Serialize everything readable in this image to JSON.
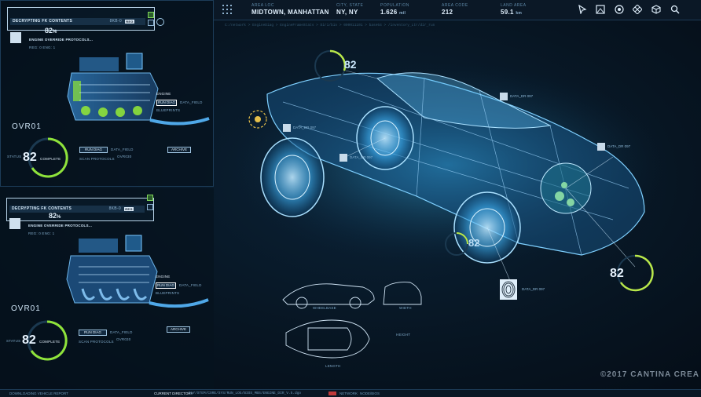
{
  "topbar": {
    "area_loc_label": "AREA LOC",
    "area_loc_value": "MIDTOWN, MANHATTAN",
    "city_state_label": "CITY, STATE",
    "city_state_value": "NY, NY",
    "population_label": "POPULATION",
    "population_value": "1.626",
    "population_unit": "mil",
    "area_code_label": "AREA CODE",
    "area_code_value": "212",
    "land_area_label": "LAND AREA",
    "land_area_value": "59.1",
    "land_area_unit": "km",
    "icons": [
      "cursor-icon",
      "image-icon",
      "target-icon",
      "move-icon",
      "cube-icon",
      "search-icon"
    ],
    "path_text": "C:/network > EngineDiag > EngineFrameStats > Dir1/bin  > 000011101 > base64  > /inventory_Ltr/dir_run"
  },
  "panel_top": {
    "title": "DECRYPTING FK CONTENTS",
    "id": "8KB-0",
    "tag": "REG",
    "percent": "82",
    "percent_suffix": "%",
    "subtitle": "ENGINE OVERRIDE PROTOCOLS...",
    "sub_line": "REG: 0  ENG: 1",
    "run_diag": "RUN DIAG",
    "data_field": "DATA_FIELD",
    "blueprint_label": "BLUEPRINTS",
    "ovr": "OVR01",
    "big_num": "82",
    "big_label": "COMPLETE",
    "run_diag2": "RUN DIAG",
    "data_field2": "DATA_FIELD",
    "scan": "SCAN PROTOCOLS",
    "ovr_small": "OVR030",
    "archive": "ARCHIVE",
    "engine_label": "ENGINE",
    "status_word": "STATUS"
  },
  "panel_bottom": {
    "title": "DECRYPTING FK CONTENTS",
    "id": "8KB-0",
    "tag": "REG",
    "percent": "82",
    "percent_suffix": "%",
    "subtitle": "ENGINE OVERRIDE PROTOCOLS...",
    "sub_line": "REG: 0  ENG: 1",
    "run_diag": "RUN DIAG",
    "data_field": "DATA_FIELD",
    "blueprint_label": "BLUEPRINTS",
    "ovr": "OVR01",
    "big_num": "82",
    "big_label": "COMPLETE",
    "run_diag2": "RUN DIAG",
    "data_field2": "DATA_FIELD",
    "scan": "SCAN PROTOCOLS",
    "ovr_small": "OVR030",
    "archive": "ARCHIVE",
    "engine_label": "ENGINE",
    "status_word": "STATUS"
  },
  "car": {
    "gauge_top": "82",
    "gauge_right": "82",
    "gauge_mid": "82",
    "tag_top_right": "DATA_DR 097",
    "tag_mid": "DATA_DR 097",
    "tag_left": "DATA_DR 097",
    "tag_right": "DATA_DR 097",
    "tag_bottom": "DATA_DR 097",
    "blueprint_left_label": "WHEELBASE",
    "blueprint_front_label": "WIDTH",
    "blueprint_bottom_label": "LENGTH",
    "blueprint_height_label": "HEIGHT"
  },
  "bottombar": {
    "status": "DOWNLOADING VEHICLE REPORT",
    "directory": "CURRENT DIRECTORY",
    "path": "SLY/STEM/CORE/SYS/RUN_LOG/BIOS_MBS/ENGINE_DIR_V.5.dgo",
    "network_a": "NETWORK",
    "network_b": "NODE/BIOS"
  },
  "copyright": "©2017 CANTINA CREA",
  "colors": {
    "accent_blue": "#2fa6ff",
    "accent_green": "#8fe33a",
    "engine_cyan": "#4fd4ff"
  }
}
